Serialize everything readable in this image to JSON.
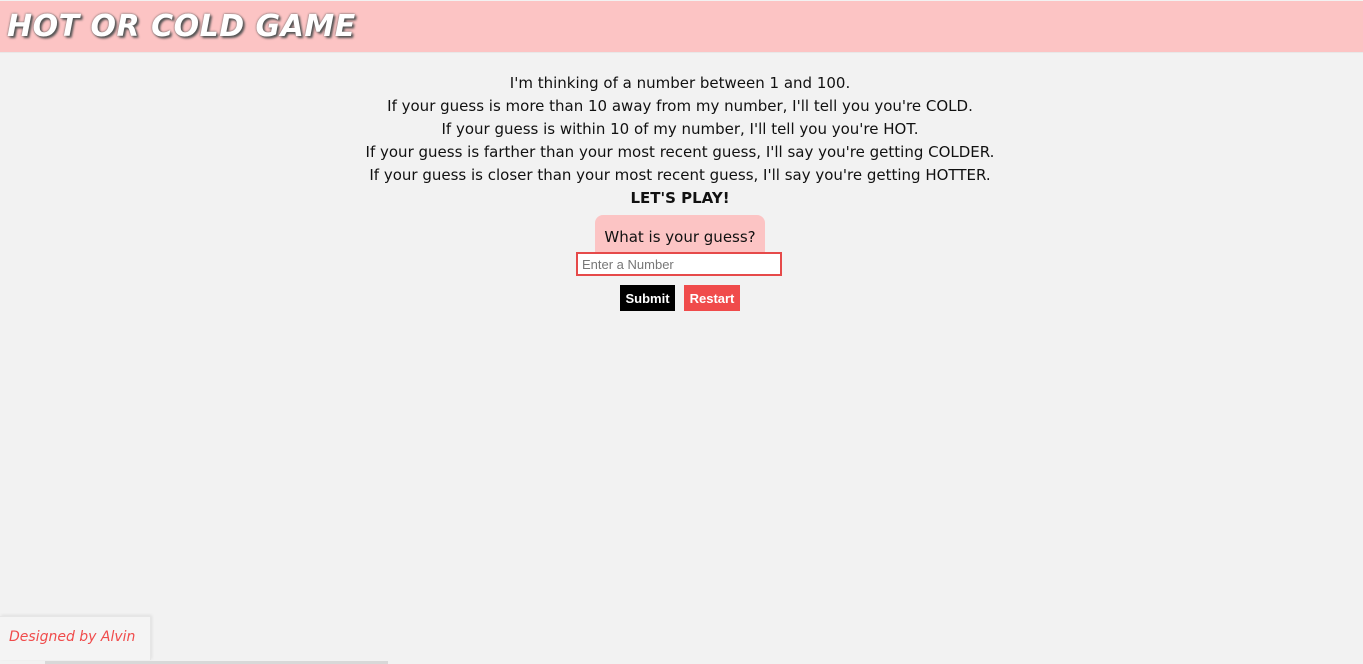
{
  "header": {
    "title": "HOT OR COLD GAME"
  },
  "instructions": {
    "lines": [
      "I'm thinking of a number between 1 and 100.",
      "If your guess is more than 10 away from my number, I'll tell you you're COLD.",
      "If your guess is within 10 of my number, I'll tell you you're HOT.",
      "If your guess is farther than your most recent guess, I'll say you're getting COLDER.",
      "If your guess is closer than your most recent guess, I'll say you're getting HOTTER."
    ],
    "call_to_action": "LET'S PLAY!"
  },
  "guess": {
    "label": "What is your guess?",
    "placeholder": "Enter a Number",
    "value": ""
  },
  "buttons": {
    "submit_label": "Submit",
    "restart_label": "Restart"
  },
  "footer": {
    "credit": "Designed by Alvin"
  },
  "colors": {
    "header_bg": "#fcc4c4",
    "page_bg": "#f2f2f2",
    "accent_red": "#f04b4b",
    "submit_bg": "#000000"
  }
}
